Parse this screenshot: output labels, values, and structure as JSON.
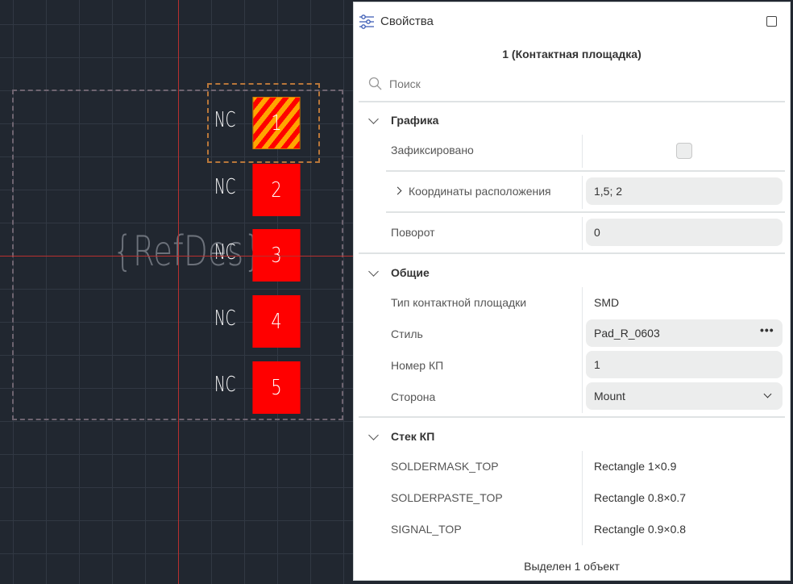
{
  "canvas": {
    "refdes": "{RefDes}",
    "pads": [
      {
        "number": "1",
        "net": "NC",
        "selected": true
      },
      {
        "number": "2",
        "net": "NC"
      },
      {
        "number": "3",
        "net": "NC"
      },
      {
        "number": "4",
        "net": "NC"
      },
      {
        "number": "5",
        "net": "NC"
      }
    ],
    "colors": {
      "pad": "#ff0000",
      "selected_hatch": "#ffa500",
      "crosshair": "#b8302f",
      "background": "#212730"
    }
  },
  "panel": {
    "title": "Свойства",
    "icon": "sliders-icon",
    "object_title": "1 (Контактная площадка)",
    "search_placeholder": "Поиск",
    "sections": {
      "graphics": {
        "title": "Графика",
        "fixed_label": "Зафиксировано",
        "fixed_checked": false,
        "coords_label": "Координаты расположения",
        "coords_value": "1,5; 2",
        "rotation_label": "Поворот",
        "rotation_value": "0"
      },
      "general": {
        "title": "Общие",
        "pad_type_label": "Тип контактной площадки",
        "pad_type_value": "SMD",
        "style_label": "Стиль",
        "style_value": "Pad_R_0603",
        "number_label": "Номер КП",
        "number_value": "1",
        "side_label": "Сторона",
        "side_value": "Mount"
      },
      "stack": {
        "title": "Стек КП",
        "rows": [
          {
            "layer": "SOLDERMASK_TOP",
            "shape": "Rectangle 1×0.9"
          },
          {
            "layer": "SOLDERPASTE_TOP",
            "shape": "Rectangle 0.8×0.7"
          },
          {
            "layer": "SIGNAL_TOP",
            "shape": "Rectangle 0.9×0.8"
          }
        ]
      }
    },
    "status": "Выделен 1 объект"
  }
}
